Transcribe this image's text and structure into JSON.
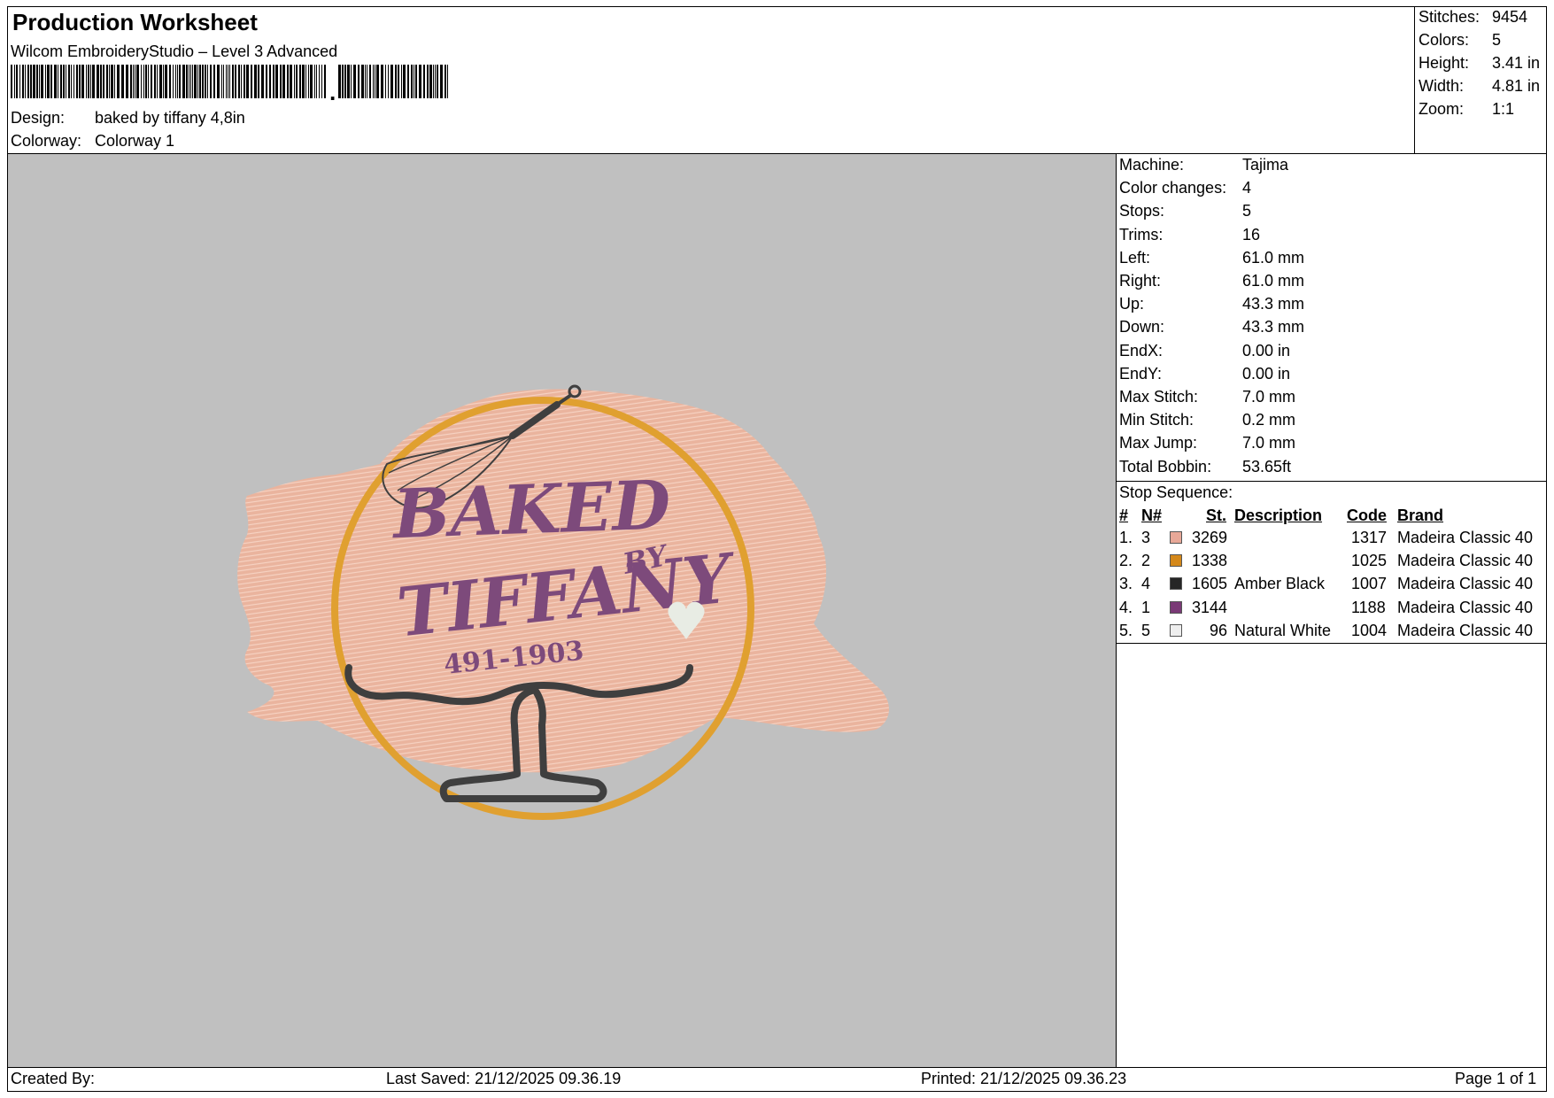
{
  "header": {
    "title": "Production Worksheet",
    "subtitle": "Wilcom EmbroideryStudio – Level 3 Advanced",
    "design_label": "Design:",
    "design_value": "baked by tiffany 4,8in",
    "colorway_label": "Colorway:",
    "colorway_value": "Colorway 1"
  },
  "summary": [
    {
      "label": "Stitches:",
      "value": "9454"
    },
    {
      "label": "Colors:",
      "value": "5"
    },
    {
      "label": "Height:",
      "value": "3.41 in"
    },
    {
      "label": "Width:",
      "value": "4.81 in"
    },
    {
      "label": "Zoom:",
      "value": "1:1"
    }
  ],
  "machine_info": [
    {
      "label": "Machine:",
      "value": "Tajima"
    },
    {
      "label": "Color changes:",
      "value": "4"
    },
    {
      "label": "Stops:",
      "value": "5"
    },
    {
      "label": "Trims:",
      "value": "16"
    },
    {
      "label": "Left:",
      "value": "61.0 mm"
    },
    {
      "label": "Right:",
      "value": "61.0 mm"
    },
    {
      "label": "Up:",
      "value": "43.3 mm"
    },
    {
      "label": "Down:",
      "value": "43.3 mm"
    },
    {
      "label": "EndX:",
      "value": "0.00 in"
    },
    {
      "label": "EndY:",
      "value": "0.00 in"
    },
    {
      "label": "Max Stitch:",
      "value": "7.0 mm"
    },
    {
      "label": "Min Stitch:",
      "value": "0.2 mm"
    },
    {
      "label": "Max Jump:",
      "value": "7.0 mm"
    },
    {
      "label": "Total Bobbin:",
      "value": "53.65ft"
    }
  ],
  "stop_sequence": {
    "heading": "Stop Sequence:",
    "columns": [
      "#",
      "N#",
      "St.",
      "Description",
      "Code",
      "Brand"
    ],
    "rows": [
      {
        "num": "1.",
        "n": "3",
        "swatch": "#e8a898",
        "st": "3269",
        "desc": "",
        "code": "1317",
        "brand": "Madeira Classic 40"
      },
      {
        "num": "2.",
        "n": "2",
        "swatch": "#d4881a",
        "st": "1338",
        "desc": "",
        "code": "1025",
        "brand": "Madeira Classic 40"
      },
      {
        "num": "3.",
        "n": "4",
        "swatch": "#262626",
        "st": "1605",
        "desc": "Amber Black",
        "code": "1007",
        "brand": "Madeira Classic 40"
      },
      {
        "num": "4.",
        "n": "1",
        "swatch": "#7a3a76",
        "st": "3144",
        "desc": "",
        "code": "1188",
        "brand": "Madeira Classic 40"
      },
      {
        "num": "5.",
        "n": "5",
        "swatch": "#eeeeee",
        "st": "96",
        "desc": "Natural White",
        "code": "1004",
        "brand": "Madeira Classic 40"
      }
    ]
  },
  "design_preview": {
    "line1": "BAKED",
    "line2": "BY",
    "line3": "TIFFANY",
    "line4": "491-1903",
    "colors": {
      "background": "#c0c0c0",
      "fill": "#eab49e",
      "ring": "#e0a030",
      "outline": "#3f3f3f",
      "text": "#7d4a7b",
      "heart": "#e8ece4"
    }
  },
  "footer": {
    "created_by": "Created By:",
    "last_saved": "Last Saved: 21/12/2025 09.36.19",
    "printed": "Printed: 21/12/2025 09.36.23",
    "page": "Page 1 of 1"
  }
}
